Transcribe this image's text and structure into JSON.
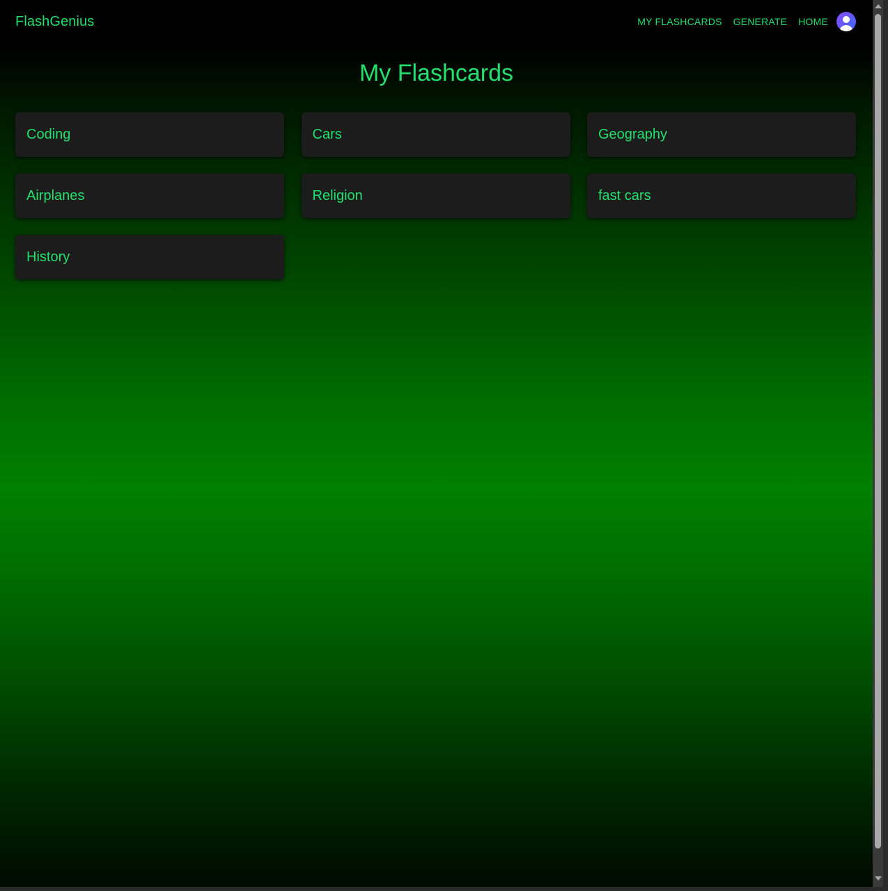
{
  "app": {
    "brand": "FlashGenius"
  },
  "nav": {
    "items": [
      {
        "label": "MY FLASHCARDS"
      },
      {
        "label": "GENERATE"
      },
      {
        "label": "HOME"
      }
    ],
    "avatar_icon": "user-avatar-icon"
  },
  "page": {
    "title": "My Flashcards"
  },
  "flashcard_sets": [
    {
      "name": "Coding"
    },
    {
      "name": "Cars"
    },
    {
      "name": "Geography"
    },
    {
      "name": "Airplanes"
    },
    {
      "name": "Religion"
    },
    {
      "name": "fast cars"
    },
    {
      "name": "History"
    }
  ],
  "theme": {
    "accent": "#22e06b",
    "card_bg": "#1c1c1c",
    "appbar_bg": "#000000",
    "gradient_peak": "#008000",
    "avatar_gradient": [
      "#8a4dff",
      "#3d6cf7"
    ]
  }
}
